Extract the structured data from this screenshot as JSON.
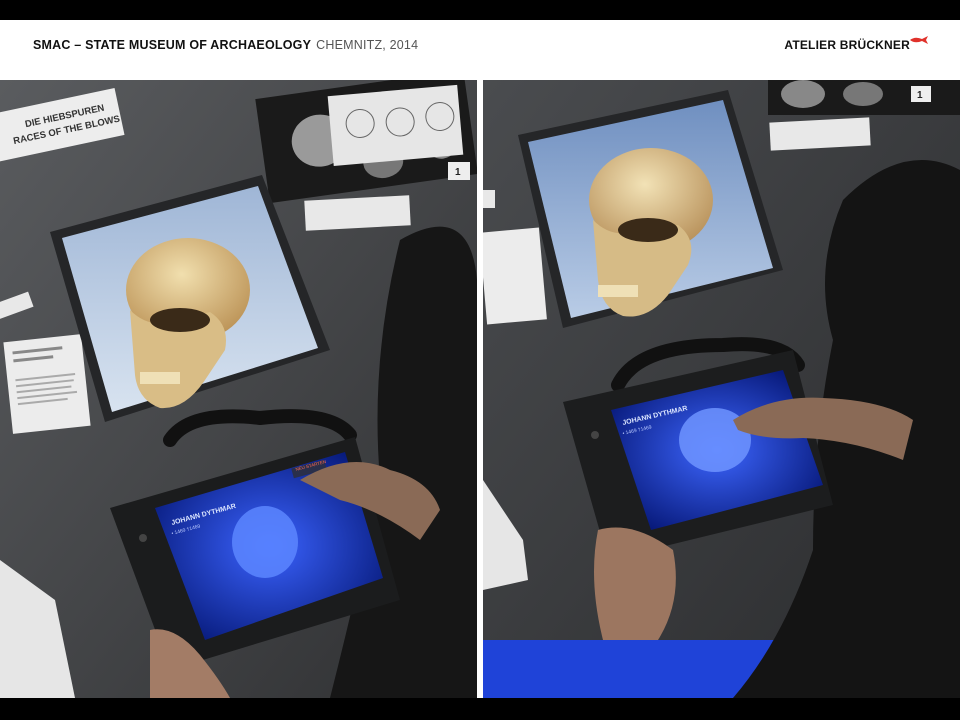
{
  "header": {
    "title_bold": "SMAC – STATE MUSEUM OF ARCHAEOLOGY",
    "title_light": "CHEMNITZ, 2014",
    "brand": "ATELIER BRÜCKNER"
  },
  "photos": {
    "left": {
      "wall_sign_line1": "DIE HIEBSPUREN",
      "wall_sign_line2": "RACES OF THE BLOWS",
      "exhibit_number": "1",
      "tablet_name": "JOHANN DYTHMAR",
      "tablet_subtitle": "• 1469 †1469",
      "tablet_button": "NEU STARTEN"
    },
    "right": {
      "exhibit_number": "1",
      "tablet_name": "JOHANN DYTHMAR",
      "tablet_subtitle": "• 1469 †1469"
    }
  },
  "colors": {
    "header_bg": "#ffffff",
    "frame_bg": "#000000",
    "wall_gray": "#4a4c4f",
    "screen_blue": "#1c3cff",
    "brand_red": "#e0322b"
  }
}
